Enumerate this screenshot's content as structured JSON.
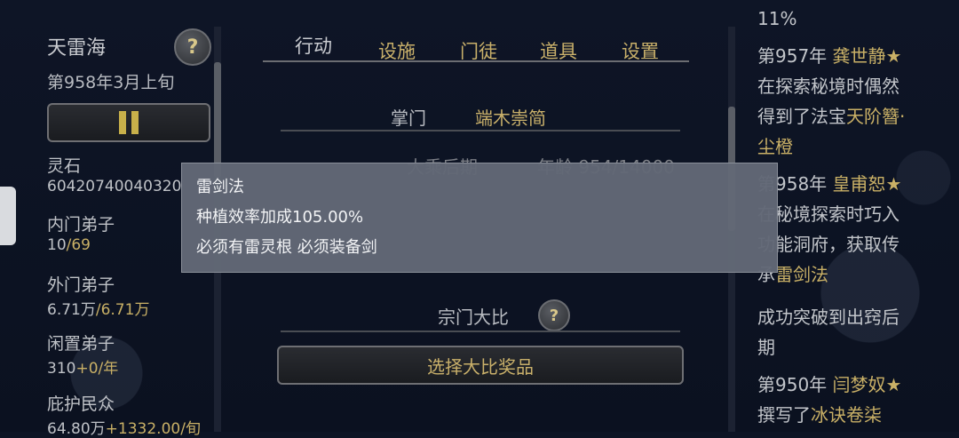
{
  "left": {
    "sect_name": "天雷海",
    "help": "?",
    "date": "第958年3月上旬",
    "stats": [
      {
        "label": "灵石",
        "value": "60420740040320"
      },
      {
        "label": "内门弟子",
        "value_a": "10",
        "value_b": "/69"
      },
      {
        "label": "外门弟子",
        "value_a": "6.71万",
        "value_b": "/6.71万"
      },
      {
        "label": "闲置弟子",
        "value_a": "310",
        "value_b": "+0/年"
      },
      {
        "label": "庇护民众",
        "value_a": "64.80万",
        "value_b": "+1332.00/旬"
      }
    ]
  },
  "tabs": [
    "行动",
    "设施",
    "门徒",
    "道具",
    "设置"
  ],
  "center": {
    "leader_label": "掌门",
    "leader_name": "端木崇简",
    "realm": "大乘后期",
    "age": "年龄 954/14000",
    "contest_label": "宗门大比",
    "contest_help": "?",
    "contest_button": "选择大比奖品"
  },
  "popup": {
    "title": "雷剑法",
    "effect": "种植效率加成105.00%",
    "requirement": "必须有雷灵根 必须装备剑"
  },
  "log": {
    "lines": [
      {
        "text": "11%"
      },
      {
        "prefix": "第957年 ",
        "gold": "龚世静★"
      },
      {
        "text": "在探索秘境时偶然"
      },
      {
        "prefix": "得到了法宝",
        "gold": "天阶簪·"
      },
      {
        "gold": "尘橙"
      },
      {
        "prefix": "第958年 ",
        "gold": "皇甫恕★"
      },
      {
        "text": "在秘境探索时巧入"
      },
      {
        "text": "功能洞府，获取传"
      },
      {
        "prefix": "承",
        "gold": "雷剑法"
      },
      {
        "text": "成功突破到出窍后"
      },
      {
        "text": "期"
      },
      {
        "prefix": "第950年 ",
        "gold": "闫梦奴★"
      },
      {
        "prefix": "撰写了",
        "gold": "冰诀卷柒"
      }
    ]
  },
  "colors": {
    "gold": "#c9b066",
    "background": "#0d1424",
    "popup": "#626876"
  }
}
